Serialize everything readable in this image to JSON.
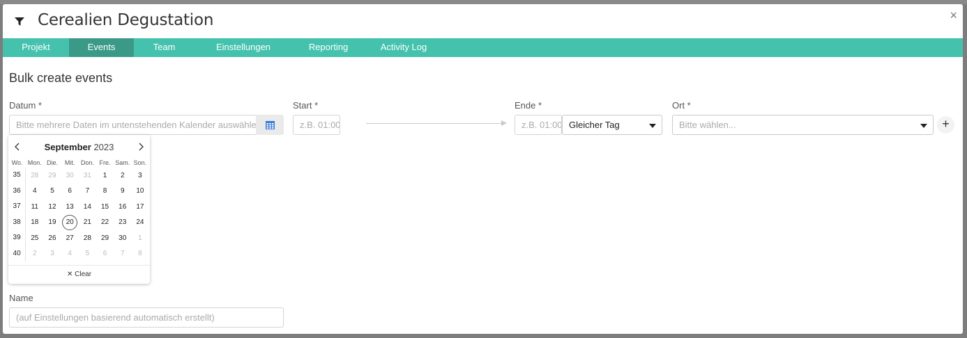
{
  "modal": {
    "title": "Cerealien Degustation",
    "close_label": "×"
  },
  "tabs": [
    {
      "label": "Projekt"
    },
    {
      "label": "Events"
    },
    {
      "label": "Team"
    },
    {
      "label": "Einstellungen"
    },
    {
      "label": "Reporting"
    },
    {
      "label": "Activity Log"
    }
  ],
  "active_tab": "Events",
  "accent_color": "#44c2ad",
  "active_tab_color": "#3a9a87",
  "form": {
    "section_title": "Bulk create events",
    "datum": {
      "label": "Datum *",
      "placeholder": "Bitte mehrere Daten im untenstehenden Kalender auswählen"
    },
    "start": {
      "label": "Start *",
      "placeholder": "z.B. 01:00"
    },
    "ende": {
      "label": "Ende *",
      "placeholder": "z.B. 01:00",
      "day_select": "Gleicher Tag"
    },
    "ort": {
      "label": "Ort *",
      "placeholder": "Bitte wählen..."
    },
    "add_label": "+",
    "name": {
      "label": "Name",
      "placeholder": "(auf Einstellungen basierend automatisch erstellt)"
    }
  },
  "calendar": {
    "month": "September",
    "year": "2023",
    "headers": [
      "Wo.",
      "Mon.",
      "Die.",
      "Mit.",
      "Don.",
      "Fre.",
      "Sam.",
      "Son."
    ],
    "weeks": [
      {
        "wk": "35",
        "days": [
          "28",
          "29",
          "30",
          "31",
          "1",
          "2",
          "3"
        ],
        "muted": [
          true,
          true,
          true,
          true,
          false,
          false,
          false
        ]
      },
      {
        "wk": "36",
        "days": [
          "4",
          "5",
          "6",
          "7",
          "8",
          "9",
          "10"
        ],
        "muted": [
          false,
          false,
          false,
          false,
          false,
          false,
          false
        ]
      },
      {
        "wk": "37",
        "days": [
          "11",
          "12",
          "13",
          "14",
          "15",
          "16",
          "17"
        ],
        "muted": [
          false,
          false,
          false,
          false,
          false,
          false,
          false
        ]
      },
      {
        "wk": "38",
        "days": [
          "18",
          "19",
          "20",
          "21",
          "22",
          "23",
          "24"
        ],
        "muted": [
          false,
          false,
          false,
          false,
          false,
          false,
          false
        ]
      },
      {
        "wk": "39",
        "days": [
          "25",
          "26",
          "27",
          "28",
          "29",
          "30",
          "1"
        ],
        "muted": [
          false,
          false,
          false,
          false,
          false,
          false,
          true
        ]
      },
      {
        "wk": "40",
        "days": [
          "2",
          "3",
          "4",
          "5",
          "6",
          "7",
          "8"
        ],
        "muted": [
          true,
          true,
          true,
          true,
          true,
          true,
          true
        ]
      }
    ],
    "today": "20",
    "clear_label": "✕ Clear"
  },
  "icons": {
    "header": "filter-icon",
    "datum_button": "calendar-icon",
    "prev": "chevron-left-icon",
    "next": "chevron-right-icon"
  }
}
